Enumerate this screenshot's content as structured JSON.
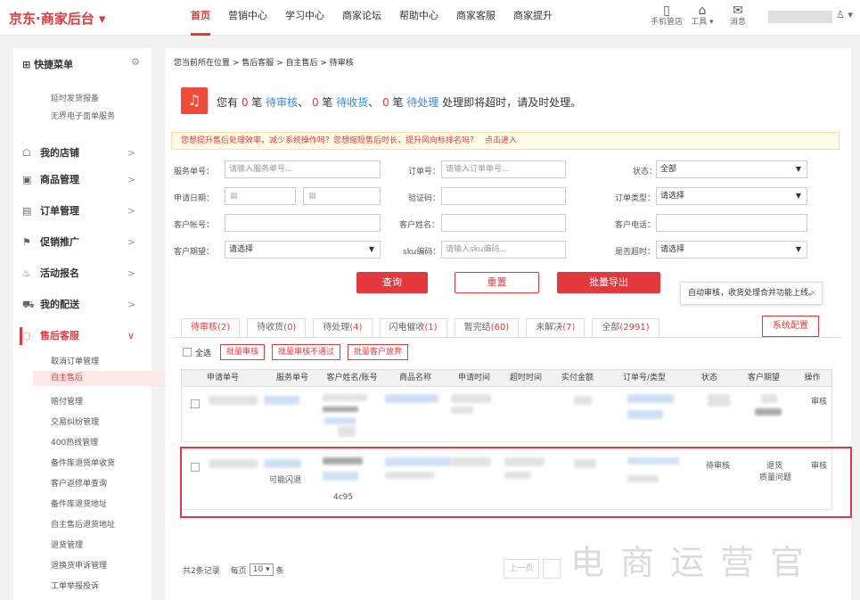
{
  "header": {
    "logo": "京东·商家后台 ▾",
    "nav": [
      "首页",
      "营销中心",
      "学习中心",
      "商家论坛",
      "帮助中心",
      "商家客服",
      "商家提升"
    ],
    "tools": [
      {
        "icon": "mobile-icon",
        "glyph": "▯",
        "label": "手机管店"
      },
      {
        "icon": "toolbox-icon",
        "glyph": "⌂",
        "label": "工具 ▾"
      },
      {
        "icon": "message-icon",
        "glyph": "✉",
        "label": "消息"
      }
    ],
    "user_glyph": "♙ ▾"
  },
  "sidebar": {
    "quick_title": "快捷菜单",
    "quick_icon": "⊞",
    "gear": "⚙",
    "quick_links": [
      "延时发货报备",
      "无界电子面单服务"
    ],
    "sections": [
      {
        "icon": "☖",
        "label": "我的店铺",
        "arrow": ">"
      },
      {
        "icon": "▣",
        "label": "商品管理",
        "arrow": ">"
      },
      {
        "icon": "▤",
        "label": "订单管理",
        "arrow": ">"
      },
      {
        "icon": "⚑",
        "label": "促销推广",
        "arrow": ">"
      },
      {
        "icon": "♨",
        "label": "活动报名",
        "arrow": ">"
      },
      {
        "icon": "⛟",
        "label": "我的配送",
        "arrow": ">"
      },
      {
        "icon": "◌",
        "label": "售后客服",
        "arrow": "∨"
      }
    ],
    "sub_items": [
      "取消订单管理",
      "自主售后",
      "赔付管理",
      "交易纠纷管理",
      "400热线管理",
      "备件库退货单收货",
      "客户返修单查询",
      "备件库退货地址",
      "自主售后退货地址",
      "退货管理",
      "退换货申诉管理",
      "工单举报投诉"
    ]
  },
  "main": {
    "breadcrumb": "您当前所在位置 > 售后客服 > 自主售后 > 待审核",
    "alert": {
      "pre": "您有 ",
      "n1": "0",
      "t1": " 笔 ",
      "l1": "待审核",
      "sep1": "、 ",
      "n2": "0",
      "t2": " 笔 ",
      "l2": "待收货",
      "sep2": "、 ",
      "n3": "0",
      "t3": " 笔 ",
      "l3": "待处理",
      "post": " 处理即将超时，请及时处理。"
    },
    "tip": "您想提升售后处理效率，减少系统操作吗？您想缩短售后时长，提升风向标排名吗？",
    "tip_link": "点击进入",
    "form": {
      "service_no_label": "服务单号：",
      "service_no_ph": "请输入服务单号...",
      "order_no_label": "订单号：",
      "order_no_ph": "请输入订单单号...",
      "status_label": "状态：",
      "status_val": "全部",
      "apply_date_label": "申请日期：",
      "verify_label": "验证码：",
      "order_type_label": "订单类型：",
      "order_type_val": "请选择",
      "cust_acct_label": "客户帐号：",
      "cust_name_label": "客户姓名：",
      "cust_phone_label": "客户电话：",
      "cust_expect_label": "客户期望：",
      "cust_expect_val": "请选择",
      "sku_label": "sku编码：",
      "sku_ph": "请输入sku编码...",
      "timeout_label": "是否超时：",
      "timeout_val": "请选择"
    },
    "buttons": {
      "query": "查询",
      "reset": "重置",
      "export": "批量导出",
      "config": "系统配置"
    },
    "popover": {
      "text": "自动审核，收货处理合并功能上线。",
      "close": "×"
    },
    "tabs": [
      {
        "name": "待审核",
        "count": "(2)"
      },
      {
        "name": "待收货",
        "count": "(0)"
      },
      {
        "name": "待处理",
        "count": "(4)"
      },
      {
        "name": "闪电催收",
        "count": "(1)"
      },
      {
        "name": "暂完结",
        "count": "(60)"
      },
      {
        "name": "未解决",
        "count": "(7)"
      },
      {
        "name": "全部",
        "count": "(2991)"
      }
    ],
    "bulk": {
      "select_all": "全选",
      "approve": "批量审核",
      "reject": "批量审核不通过",
      "abandon": "批量客户放弃"
    },
    "columns": [
      "申请单号",
      "服务单号",
      "客户姓名/账号",
      "商品名称",
      "申请时间",
      "超时时间",
      "实付金额",
      "订单号/类型",
      "状态",
      "客户期望",
      "操作"
    ],
    "rows": [
      {
        "status": "",
        "expect": "",
        "action": "审核",
        "flag": ""
      },
      {
        "status": "待审核",
        "expect": "退货\n质量问题",
        "expect1": "退货",
        "expect2": "质量问题",
        "action": "审核",
        "flag": "可能闪退",
        "sku_frag": "4c95"
      }
    ],
    "pagination": {
      "total": "共2条记录",
      "per_page_label": "每页",
      "per_page": "10 ▾",
      "unit": "条",
      "prev": "上一页"
    },
    "watermark": "电商运营官"
  }
}
